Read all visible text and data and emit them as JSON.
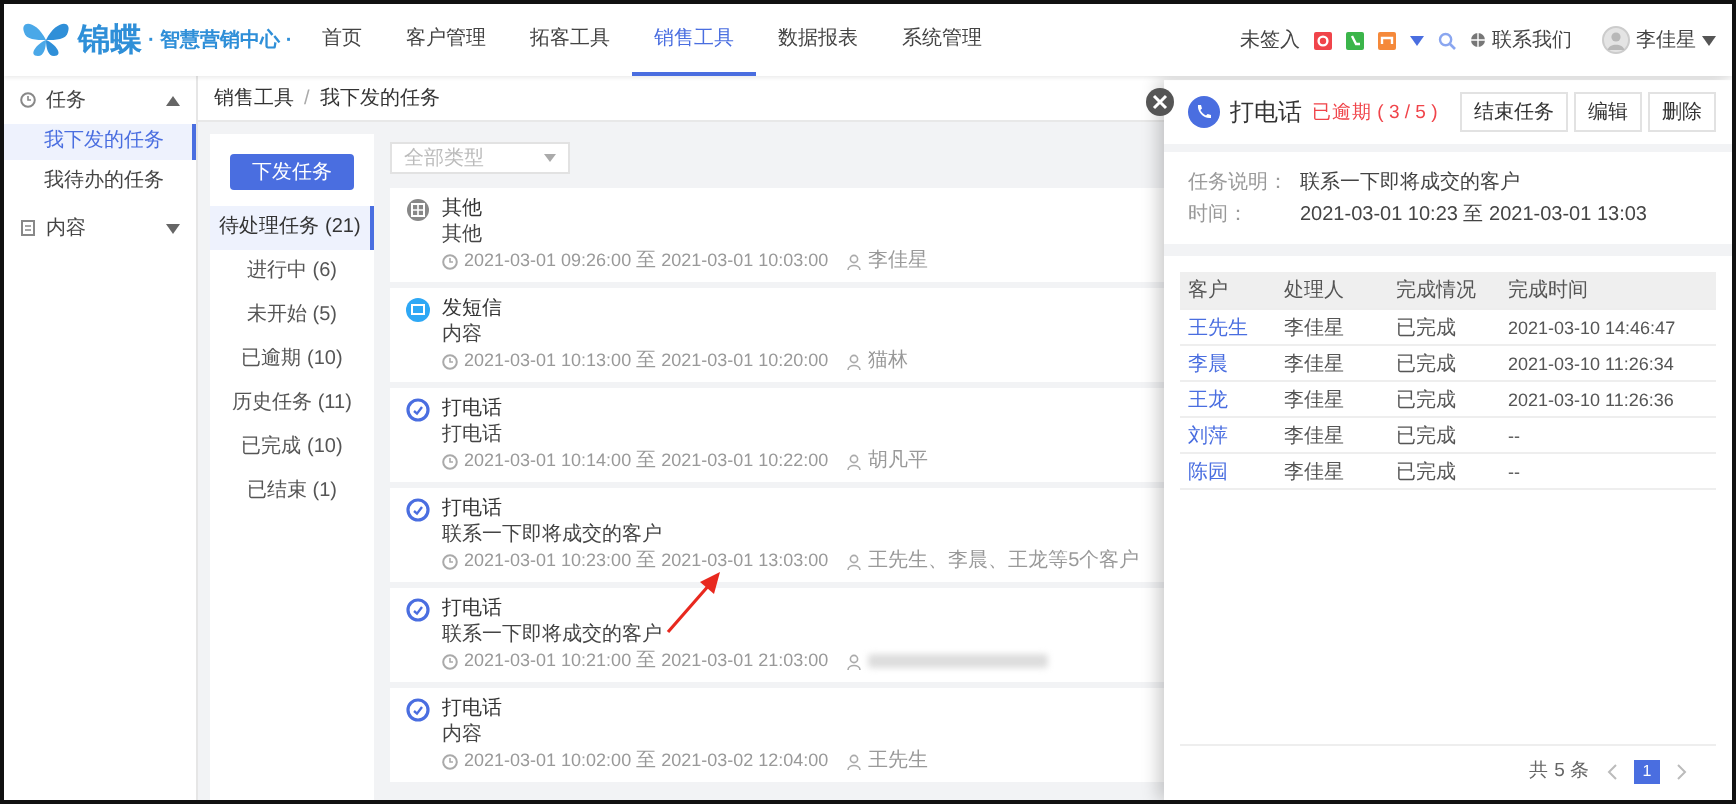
{
  "header": {
    "logo_text": "锦蝶",
    "logo_sub": "· 智慧营销中心 ·",
    "nav": [
      {
        "label": "首页",
        "selected": false
      },
      {
        "label": "客户管理",
        "selected": false
      },
      {
        "label": "拓客工具",
        "selected": false
      },
      {
        "label": "销售工具",
        "selected": true
      },
      {
        "label": "数据报表",
        "selected": false
      },
      {
        "label": "系统管理",
        "selected": false
      }
    ],
    "checkin": "未签入",
    "contact": "联系我们",
    "user": "李佳星"
  },
  "sidebar": {
    "groups": [
      {
        "label": "任务",
        "expanded": true,
        "children": [
          {
            "label": "我下发的任务",
            "selected": true
          },
          {
            "label": "我待办的任务",
            "selected": false
          }
        ]
      },
      {
        "label": "内容",
        "expanded": false
      }
    ]
  },
  "breadcrumb": [
    "销售工具",
    "我下发的任务"
  ],
  "breadcrumb_separator": "/",
  "new_task_button": "下发任务",
  "type_select": {
    "placeholder": "全部类型"
  },
  "filters": [
    {
      "label": "待处理任务 (21)",
      "selected": true
    },
    {
      "label": "进行中 (6)",
      "selected": false
    },
    {
      "label": "未开始 (5)",
      "selected": false
    },
    {
      "label": "已逾期 (10)",
      "selected": false
    },
    {
      "label": "历史任务 (11)",
      "selected": false
    },
    {
      "label": "已完成 (10)",
      "selected": false
    },
    {
      "label": "已结束 (1)",
      "selected": false
    }
  ],
  "cards": [
    {
      "kind": "other",
      "title": "其他",
      "desc": "其他",
      "time": {
        "from": "2021-03-01 09:26:00",
        "sep": "至",
        "to": "2021-03-01 10:03:00"
      },
      "assignee": "李佳星",
      "blurred": false
    },
    {
      "kind": "sms",
      "title": "发短信",
      "desc": "内容",
      "time": {
        "from": "2021-03-01 10:13:00",
        "sep": "至",
        "to": "2021-03-01 10:20:00"
      },
      "assignee": "猫林",
      "blurred": false
    },
    {
      "kind": "call",
      "title": "打电话",
      "desc": "打电话",
      "time": {
        "from": "2021-03-01 10:14:00",
        "sep": "至",
        "to": "2021-03-01 10:22:00"
      },
      "assignee": "胡凡平",
      "blurred": false
    },
    {
      "kind": "call",
      "title": "打电话",
      "desc": "联系一下即将成交的客户",
      "time": {
        "from": "2021-03-01 10:23:00",
        "sep": "至",
        "to": "2021-03-01 13:03:00"
      },
      "assignee": "王先生、李晨、王龙等5个客户",
      "blurred": false
    },
    {
      "kind": "call",
      "title": "打电话",
      "desc": "联系一下即将成交的客户",
      "time": {
        "from": "2021-03-01 10:21:00",
        "sep": "至",
        "to": "2021-03-01 21:03:00"
      },
      "blurred": true
    },
    {
      "kind": "call",
      "title": "打电话",
      "desc": "内容",
      "time": {
        "from": "2021-03-01 10:02:00",
        "sep": "至",
        "to": "2021-03-02 12:04:00"
      },
      "assignee": "王先生",
      "blurred": false
    }
  ],
  "drawer": {
    "title": "打电话",
    "status": "已逾期 ( 3 / 5 )",
    "buttons": [
      "结束任务",
      "编辑",
      "删除"
    ],
    "info": [
      {
        "label": "任务说明：",
        "value": "联系一下即将成交的客户"
      },
      {
        "label": "时间：",
        "value": "2021-03-01 10:23 至 2021-03-01 13:03"
      }
    ],
    "table": {
      "columns": [
        "客户",
        "处理人",
        "完成情况",
        "完成时间"
      ],
      "rows": [
        [
          "王先生",
          "李佳星",
          "已完成",
          "2021-03-10 14:46:47"
        ],
        [
          "李晨",
          "李佳星",
          "已完成",
          "2021-03-10 11:26:34"
        ],
        [
          "王龙",
          "李佳星",
          "已完成",
          "2021-03-10 11:26:36"
        ],
        [
          "刘萍",
          "李佳星",
          "已完成",
          "--"
        ],
        [
          "陈园",
          "李佳星",
          "已完成",
          "--"
        ]
      ]
    },
    "pagination": {
      "total": "共 5 条",
      "pages": [
        {
          "label": "1",
          "selected": true
        }
      ]
    }
  }
}
